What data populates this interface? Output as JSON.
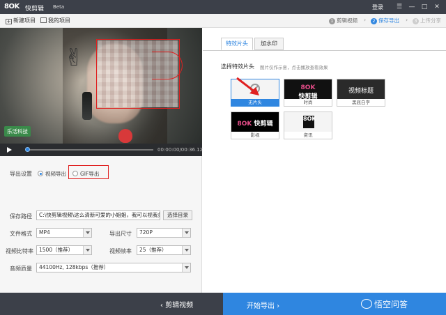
{
  "titlebar": {
    "logo": "8OK",
    "app_name": "快剪辑",
    "beta": "Beta",
    "login": "登录",
    "menu": "☰",
    "minimize": "—",
    "maximize": "□",
    "close": "✕"
  },
  "toolbar": {
    "new_project": "新建项目",
    "my_projects": "我的项目",
    "steps": [
      {
        "num": "1",
        "label": "剪辑视频"
      },
      {
        "num": "2",
        "label": "保存导出"
      },
      {
        "num": "3",
        "label": "上传分享"
      }
    ]
  },
  "video": {
    "tag": "乐活科技",
    "timecode": "00:00:00/00:36.12",
    "progress": 0.01
  },
  "settings": {
    "export_label": "导出设置",
    "video_export": "视频导出",
    "gif_export": "GIF导出",
    "path_label": "保存路径",
    "path_value": "C:\\快剪辑视频\\这么清新可爱的小姐姐，我可以视我弟",
    "choose_dir": "选择目录",
    "format_label": "文件格式",
    "format_value": "MP4",
    "size_label": "导出尺寸",
    "size_value": "720P",
    "bitrate_label": "视频比特率",
    "bitrate_value": "1500（推荐）",
    "fps_label": "视频帧率",
    "fps_value": "25（推荐）",
    "audio_label": "音频质量",
    "audio_value": "44100Hz, 128kbps（推荐）"
  },
  "right": {
    "tab_intro": "特效片头",
    "tab_watermark": "加水印",
    "section_title": "选择特效片头",
    "section_hint": "图片仅作示意，点击播放查看效果",
    "tiles": [
      {
        "caption": "无片头"
      },
      {
        "caption": "时尚",
        "brand_mark": "8OK",
        "brand_name": "快剪辑"
      },
      {
        "caption": "黑底白字",
        "title": "视频标题"
      },
      {
        "caption": "影视",
        "brand_mark": "8OK",
        "brand_name": "快剪辑"
      },
      {
        "caption": "资讯",
        "icon_text": "8OK"
      }
    ]
  },
  "bottom": {
    "back": "‹ 剪辑视频",
    "export": "开始导出 ›",
    "watermark": "悟空问答"
  },
  "colors": {
    "accent": "#2f86e0",
    "dark": "#3c4049",
    "highlight": "#e02020"
  }
}
